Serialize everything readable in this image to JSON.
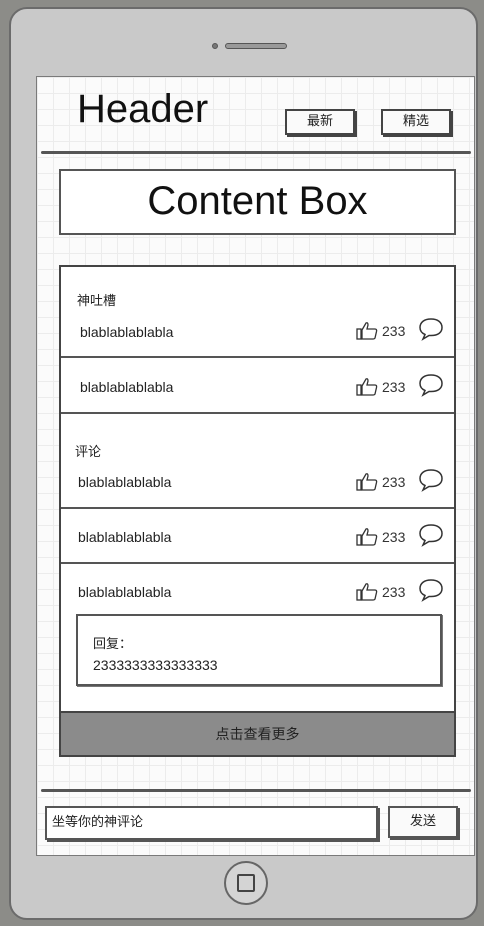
{
  "header": {
    "title": "Header",
    "tab_latest": "最新",
    "tab_featured": "精选"
  },
  "content_box": "Content Box",
  "hot": {
    "label": "神吐槽",
    "items": [
      {
        "text": "blablablablabla",
        "likes": "233"
      },
      {
        "text": "blablablablabla",
        "likes": "233"
      }
    ]
  },
  "comments": {
    "label": "评论",
    "items": [
      {
        "text": "blablablablabla",
        "likes": "233"
      },
      {
        "text": "blablablablabla",
        "likes": "233"
      },
      {
        "text": "blablablablabla",
        "likes": "233"
      }
    ],
    "reply": {
      "label": "回复：",
      "text": "2333333333333333"
    }
  },
  "more_label": "点击查看更多",
  "composer": {
    "placeholder": "坐等你的神评论",
    "send_label": "发送"
  },
  "icons": {
    "like": "thumbs-up-icon",
    "comment": "speech-bubble-icon",
    "home": "home-button-square-icon"
  }
}
